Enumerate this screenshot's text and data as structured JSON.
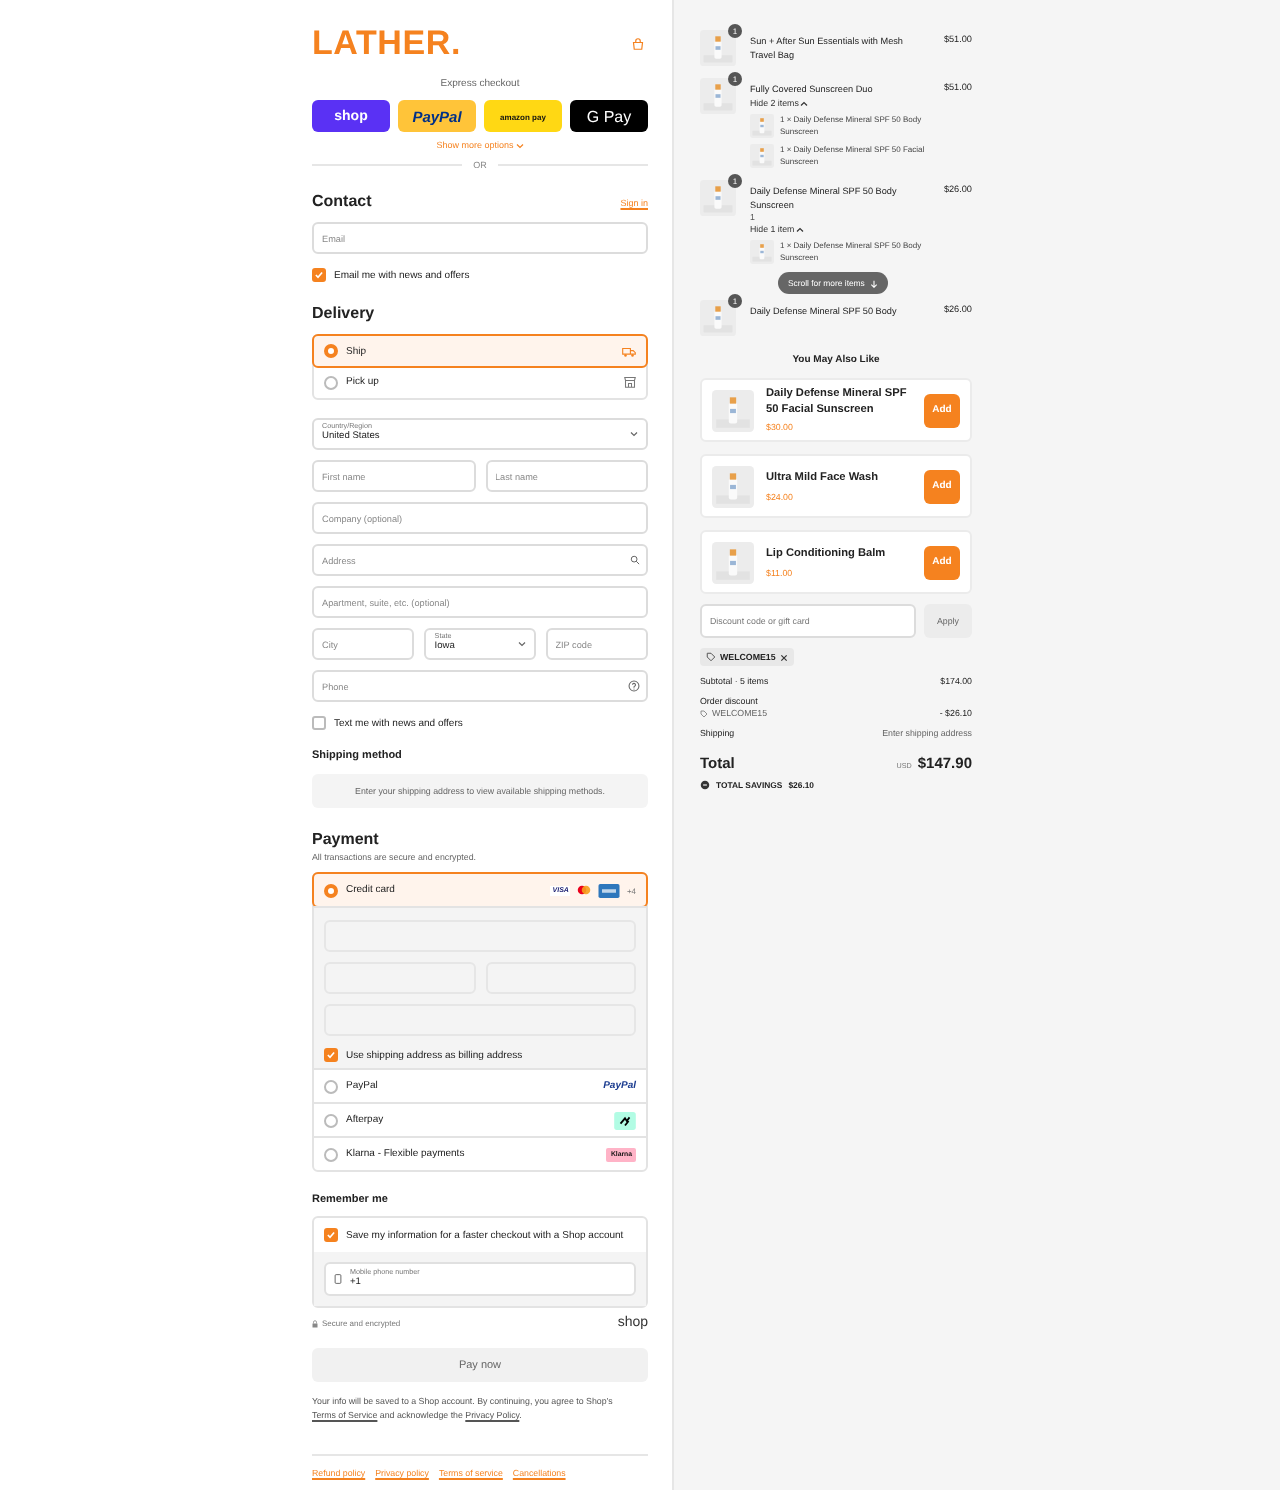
{
  "header": {
    "logo": "LATHER."
  },
  "express": {
    "title": "Express checkout",
    "buttons": [
      {
        "kind": "shop",
        "label": "shop"
      },
      {
        "kind": "paypal",
        "label": "PayPal"
      },
      {
        "kind": "amazon",
        "label": "amazon pay"
      },
      {
        "kind": "gpay",
        "label": "G Pay"
      }
    ],
    "more": "Show more options",
    "divider": "OR"
  },
  "contact": {
    "heading": "Contact",
    "sign_in": "Sign in",
    "email": {
      "placeholder": "Email"
    },
    "news": {
      "label": "Email me with news and offers",
      "checked": true
    }
  },
  "delivery": {
    "heading": "Delivery",
    "options": [
      {
        "kind": "ship",
        "label": "Ship",
        "selected": true
      },
      {
        "kind": "pickup",
        "label": "Pick up",
        "selected": false
      }
    ],
    "rows": [
      [
        {
          "kind": "select",
          "label": "Country/Region",
          "value": "United States"
        }
      ],
      [
        {
          "kind": "text",
          "placeholder": "First name"
        },
        {
          "kind": "text",
          "placeholder": "Last name"
        }
      ],
      [
        {
          "kind": "text",
          "placeholder": "Company (optional)"
        }
      ],
      [
        {
          "kind": "search",
          "placeholder": "Address"
        }
      ],
      [
        {
          "kind": "text",
          "placeholder": "Apartment, suite, etc. (optional)"
        }
      ],
      [
        {
          "kind": "text",
          "placeholder": "City"
        },
        {
          "kind": "select",
          "label": "State",
          "value": "Iowa"
        },
        {
          "kind": "text",
          "placeholder": "ZIP code"
        }
      ],
      [
        {
          "kind": "help",
          "placeholder": "Phone"
        }
      ]
    ],
    "sms": {
      "label": "Text me with news and offers",
      "checked": false
    }
  },
  "shipping_method": {
    "heading": "Shipping method",
    "notice": "Enter your shipping address to view available shipping methods."
  },
  "payment": {
    "heading": "Payment",
    "subtitle": "All transactions are secure and encrypted.",
    "methods": [
      {
        "kind": "card",
        "label": "Credit card",
        "selected": true,
        "brand": "VISA",
        "more": "+4"
      },
      {
        "kind": "paypal",
        "label": "PayPal",
        "selected": false,
        "badge": "PayPal"
      },
      {
        "kind": "afterpay",
        "label": "Afterpay",
        "selected": false
      },
      {
        "kind": "klarna",
        "label": "Klarna - Flexible payments",
        "selected": false,
        "badge": "Klarna"
      }
    ],
    "billing": {
      "label": "Use shipping address as billing address",
      "checked": true
    }
  },
  "remember": {
    "heading": "Remember me",
    "save": {
      "label": "Save my information for a faster checkout with a Shop account",
      "checked": true
    },
    "phone": {
      "label": "Mobile phone number",
      "value": "+1"
    }
  },
  "checkout": {
    "secure": "Secure and encrypted",
    "shop_logo": "shop",
    "pay": "Pay now",
    "legal": [
      {
        "kind": "text",
        "text": "Your info will be saved to a Shop account. By continuing, you agree to Shop’s "
      },
      {
        "kind": "link",
        "text": "Terms of Service"
      },
      {
        "kind": "text",
        "text": " and acknowledge the "
      },
      {
        "kind": "link",
        "text": "Privacy Policy"
      },
      {
        "kind": "text",
        "text": "."
      }
    ]
  },
  "footer_links": [
    "Refund policy",
    "Privacy policy",
    "Terms of service",
    "Cancellations"
  ],
  "cart": {
    "items": [
      {
        "name": "Sun + After Sun Essentials with Mesh Travel Bag",
        "quantity": "1",
        "price": "$51.00"
      },
      {
        "name": "Fully Covered Sunscreen Duo",
        "quantity": "1",
        "price": "$51.00",
        "toggle": "Hide 2 items",
        "expanded": true,
        "components": [
          "1 × Daily Defense Mineral SPF 50 Body Sunscreen",
          "1 × Daily Defense Mineral SPF 50 Facial Sunscreen"
        ]
      },
      {
        "name": "Daily Defense Mineral SPF 50 Body Sunscreen",
        "quantity": "1",
        "price": "$26.00",
        "detail": "1",
        "toggle": "Hide 1 item",
        "expanded": true,
        "components": [
          "1 × Daily Defense Mineral SPF 50 Body Sunscreen"
        ]
      },
      {
        "name": "Daily Defense Mineral SPF 50 Body",
        "quantity": "1",
        "price": "$26.00"
      }
    ],
    "scroll_hint": "Scroll for more items"
  },
  "upsell": {
    "heading": "You May Also Like",
    "products": [
      {
        "name": "Daily Defense Mineral SPF 50 Facial Sunscreen",
        "price": "$30.00",
        "button": "Add"
      },
      {
        "name": "Ultra Mild Face Wash",
        "price": "$24.00",
        "button": "Add"
      },
      {
        "name": "Lip Conditioning Balm",
        "price": "$11.00",
        "button": "Add"
      }
    ]
  },
  "discount": {
    "placeholder": "Discount code or gift card",
    "button": "Apply",
    "codes": [
      "WELCOME15"
    ]
  },
  "summary": {
    "subtotal_label": "Subtotal · 5 items",
    "subtotal": "$174.00",
    "discount_label": "Order discount",
    "discount_code": "WELCOME15",
    "discount_amount": "- $26.10",
    "shipping_label": "Shipping",
    "shipping": "Enter shipping address",
    "total_label": "Total",
    "currency": "USD",
    "total": "$147.90",
    "savings_label": "TOTAL SAVINGS",
    "savings": "$26.10"
  }
}
